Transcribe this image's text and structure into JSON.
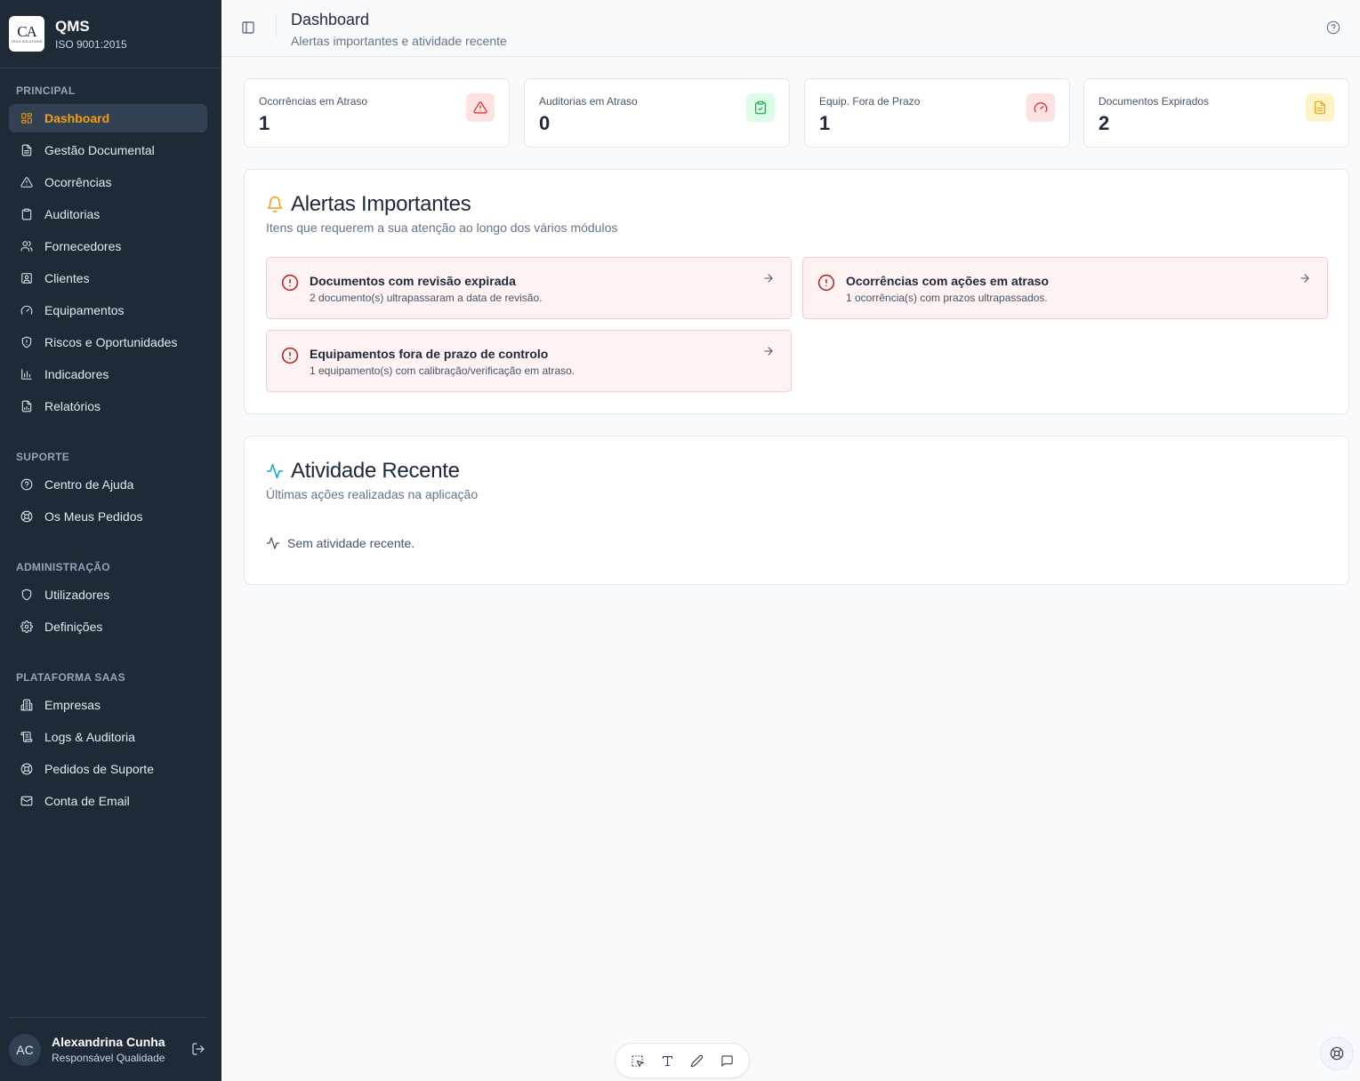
{
  "brand": {
    "logo_text": "CA",
    "logo_sub": "TECH SOLUTIONS",
    "title": "QMS",
    "subtitle": "ISO 9001:2015"
  },
  "sidebar": {
    "sections": [
      {
        "title": "PRINCIPAL",
        "items": [
          {
            "label": "Dashboard",
            "icon": "dashboard-icon",
            "active": true
          },
          {
            "label": "Gestão Documental",
            "icon": "document-icon"
          },
          {
            "label": "Ocorrências",
            "icon": "warning-icon"
          },
          {
            "label": "Auditorias",
            "icon": "clipboard-icon"
          },
          {
            "label": "Fornecedores",
            "icon": "users-icon"
          },
          {
            "label": "Clientes",
            "icon": "contact-icon"
          },
          {
            "label": "Equipamentos",
            "icon": "gauge-icon"
          },
          {
            "label": "Riscos e Oportunidades",
            "icon": "shield-alert-icon"
          },
          {
            "label": "Indicadores",
            "icon": "bar-chart-icon"
          },
          {
            "label": "Relatórios",
            "icon": "report-icon"
          }
        ]
      },
      {
        "title": "SUPORTE",
        "items": [
          {
            "label": "Centro de Ajuda",
            "icon": "help-circle-icon"
          },
          {
            "label": "Os Meus Pedidos",
            "icon": "lifebuoy-icon"
          }
        ]
      },
      {
        "title": "ADMINISTRAÇÃO",
        "items": [
          {
            "label": "Utilizadores",
            "icon": "shield-icon"
          },
          {
            "label": "Definições",
            "icon": "gear-icon"
          }
        ]
      },
      {
        "title": "PLATAFORMA SAAS",
        "items": [
          {
            "label": "Empresas",
            "icon": "building-icon"
          },
          {
            "label": "Logs & Auditoria",
            "icon": "scroll-icon"
          },
          {
            "label": "Pedidos de Suporte",
            "icon": "lifebuoy-icon"
          },
          {
            "label": "Conta de Email",
            "icon": "mail-icon"
          }
        ]
      }
    ]
  },
  "user": {
    "initials": "AC",
    "name": "Alexandrina Cunha",
    "role": "Responsável Qualidade"
  },
  "header": {
    "title": "Dashboard",
    "subtitle": "Alertas importantes e atividade recente"
  },
  "stats": [
    {
      "label": "Ocorrências em Atraso",
      "value": "1",
      "icon": "warning-icon",
      "color": "#dc2626",
      "bg": "#fee2e2"
    },
    {
      "label": "Auditorias em Atraso",
      "value": "0",
      "icon": "clipboard-check-icon",
      "color": "#16a34a",
      "bg": "#dcfce7"
    },
    {
      "label": "Equip. Fora de Prazo",
      "value": "1",
      "icon": "gauge-icon",
      "color": "#dc2626",
      "bg": "#fee2e2"
    },
    {
      "label": "Documentos Expirados",
      "value": "2",
      "icon": "document-icon",
      "color": "#f59e0b",
      "bg": "#fef3c7"
    }
  ],
  "alerts": {
    "title": "Alertas Importantes",
    "subtitle": "Itens que requerem a sua atenção ao longo dos vários módulos",
    "items": [
      {
        "title": "Documentos com revisão expirada",
        "desc": "2 documento(s) ultrapassaram a data de revisão."
      },
      {
        "title": "Ocorrências com ações em atraso",
        "desc": "1 ocorrência(s) com prazos ultrapassados."
      },
      {
        "title": "Equipamentos fora de prazo de controlo",
        "desc": "1 equipamento(s) com calibração/verificação em atraso."
      }
    ]
  },
  "activity": {
    "title": "Atividade Recente",
    "subtitle": "Últimas ações realizadas na aplicação",
    "empty": "Sem atividade recente."
  },
  "colors": {
    "sidebar_bg": "#1f2a37",
    "accent": "#f59e0b",
    "alert_bg": "#fef2f2",
    "activity_icon": "#0ea5e9"
  }
}
